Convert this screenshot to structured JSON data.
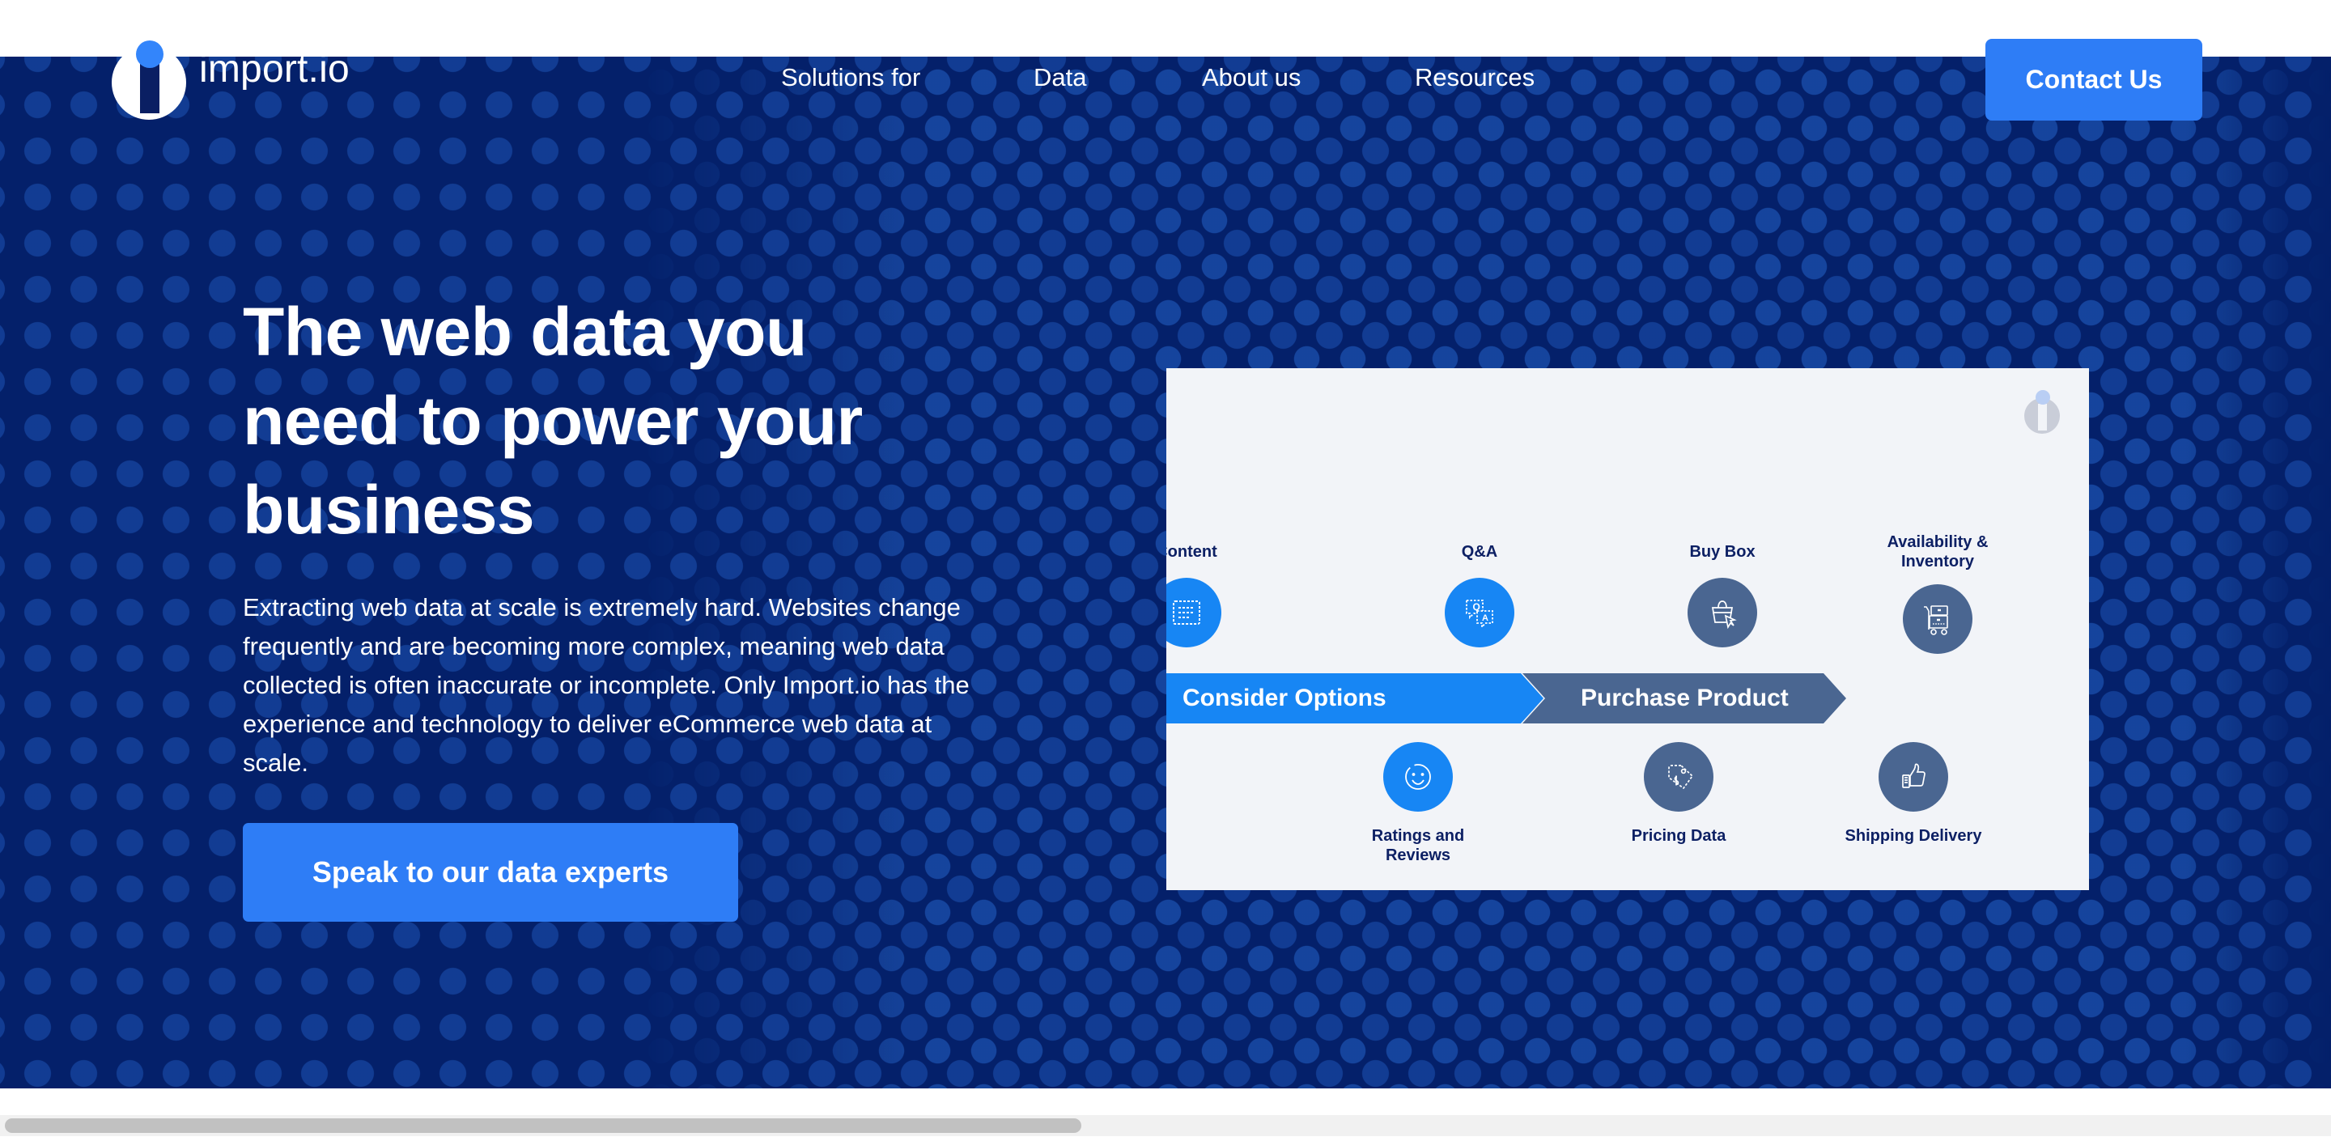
{
  "brand": {
    "name": "import.io",
    "logo_icon": "import-io-logo-icon",
    "accent_blue": "#2E7DF6",
    "navy": "#04206A",
    "panel_bg": "#F2F4F8",
    "slate": "#4A6691"
  },
  "header": {
    "nav_items": [
      {
        "label": "Solutions for"
      },
      {
        "label": "Data"
      },
      {
        "label": "About us"
      },
      {
        "label": "Resources"
      }
    ],
    "cta_label": "Contact Us"
  },
  "hero": {
    "headline": "The web data you need to power your business",
    "body": "Extracting web data at scale is extremely hard. Websites change frequently and are becoming more complex, meaning web data collected is often inaccurate or incomplete. Only Import.io has the experience and technology to deliver eCommerce web data at scale.",
    "cta_label": "Speak to our data experts"
  },
  "infographic": {
    "watermark_icon": "import-io-watermark-icon",
    "stages": [
      {
        "label": "Consider Options",
        "color": "#1786F4"
      },
      {
        "label": "Purchase Product",
        "color": "#4A6691"
      }
    ],
    "top_nodes": [
      {
        "label": "Content",
        "icon": "content-grid-icon",
        "color": "blue",
        "clipped": true
      },
      {
        "label": "Q&A",
        "icon": "question-answer-icon",
        "color": "blue"
      },
      {
        "label": "Buy Box",
        "icon": "buy-box-cursor-icon",
        "color": "slate"
      },
      {
        "label": "Availability &\nInventory",
        "icon": "inventory-cart-icon",
        "color": "slate"
      }
    ],
    "bottom_nodes": [
      {
        "label": "Ratings and\nReviews",
        "icon": "smiley-face-icon",
        "color": "blue"
      },
      {
        "label": "Pricing Data",
        "icon": "price-tag-icon",
        "color": "slate"
      },
      {
        "label": "Shipping Delivery",
        "icon": "thumbs-up-icon",
        "color": "slate"
      }
    ]
  }
}
